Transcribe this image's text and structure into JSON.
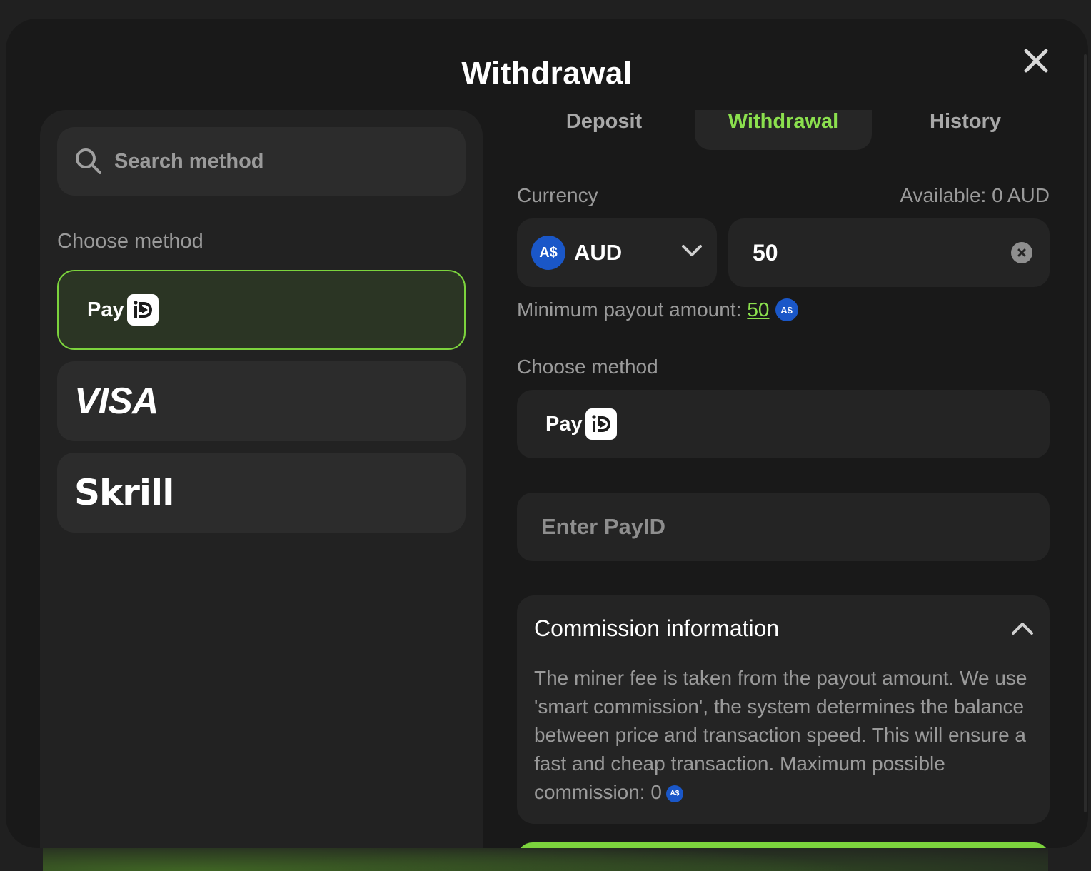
{
  "modal": {
    "title": "Withdrawal",
    "colors": {
      "accent": "#8be04e",
      "coin": "#1a57c8",
      "background": "#191919"
    }
  },
  "left": {
    "search_placeholder": "Search method",
    "section_label": "Choose method",
    "methods": [
      {
        "id": "payid",
        "label": "Pay",
        "icon": "payid-logo",
        "selected": true
      },
      {
        "id": "visa",
        "label": "VISA",
        "icon": "visa-logo",
        "selected": false
      },
      {
        "id": "skrill",
        "label": "Skrill",
        "icon": "skrill-logo",
        "selected": false
      }
    ]
  },
  "tabs": [
    {
      "label": "Deposit",
      "active": false
    },
    {
      "label": "Withdrawal",
      "active": true
    },
    {
      "label": "History",
      "active": false
    }
  ],
  "form": {
    "currency_label": "Currency",
    "available": "Available: 0 AUD",
    "currency_symbol": "A$",
    "currency_code": "AUD",
    "amount_value": "50",
    "min_payout_label": "Minimum payout amount:",
    "min_payout_value": "50",
    "method_label": "Choose method",
    "selected_method_label": "Pay",
    "payid_placeholder": "Enter PayID"
  },
  "commission": {
    "title": "Commission information",
    "text": "The miner fee is taken from the payout amount. We use 'smart commission', the system determines the balance between price and transaction speed. This will ensure a fast and cheap transaction. Maximum possible commission: 0"
  }
}
